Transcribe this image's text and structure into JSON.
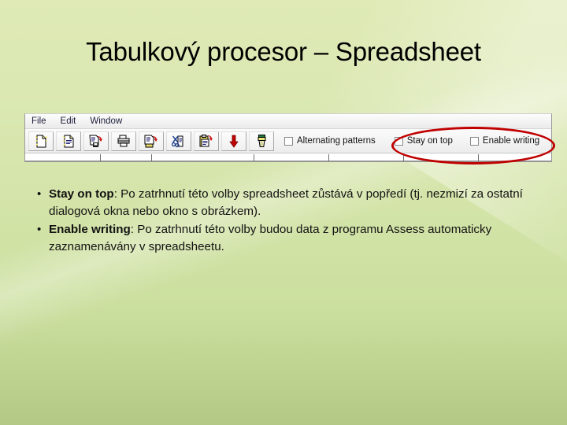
{
  "slide": {
    "title": "Tabulkový procesor – Spreadsheet",
    "background_color_top": "#dfeab6",
    "background_color_bottom": "#b2c884",
    "highlight_color": "#c00000"
  },
  "app_window": {
    "menubar": {
      "items": [
        {
          "label": "File"
        },
        {
          "label": "Edit"
        },
        {
          "label": "Window"
        }
      ]
    },
    "toolbar": {
      "buttons": [
        {
          "name": "new-document-icon",
          "tip": "New"
        },
        {
          "name": "open-document-icon",
          "tip": "Open"
        },
        {
          "name": "save-document-icon",
          "tip": "Save"
        },
        {
          "name": "print-icon",
          "tip": "Print"
        },
        {
          "name": "print-preview-icon",
          "tip": "Print preview"
        },
        {
          "name": "cut-scissors-icon",
          "tip": "Cut"
        },
        {
          "name": "paste-clipboard-icon",
          "tip": "Paste"
        },
        {
          "name": "down-arrow-icon",
          "tip": "Insert down"
        },
        {
          "name": "brush-icon",
          "tip": "Format brush"
        }
      ],
      "checkboxes": [
        {
          "label": "Alternating patterns",
          "checked": false,
          "highlighted": false
        },
        {
          "label": "Stay on top",
          "checked": false,
          "highlighted": true
        },
        {
          "label": "Enable writing",
          "checked": false,
          "highlighted": true
        }
      ]
    }
  },
  "bullets": [
    {
      "marker": "•",
      "term": "Stay on top",
      "separator": ": ",
      "description": "Po zatrhnutí této volby spreadsheet zůstává v popředí (tj. nezmizí za ostatní dialogová okna nebo okno s obrázkem)."
    },
    {
      "marker": "•",
      "term": "Enable writing",
      "separator": ": ",
      "description": "Po zatrhnutí této volby budou data z programu Assess automaticky zaznamenávány v spreadsheetu."
    }
  ]
}
